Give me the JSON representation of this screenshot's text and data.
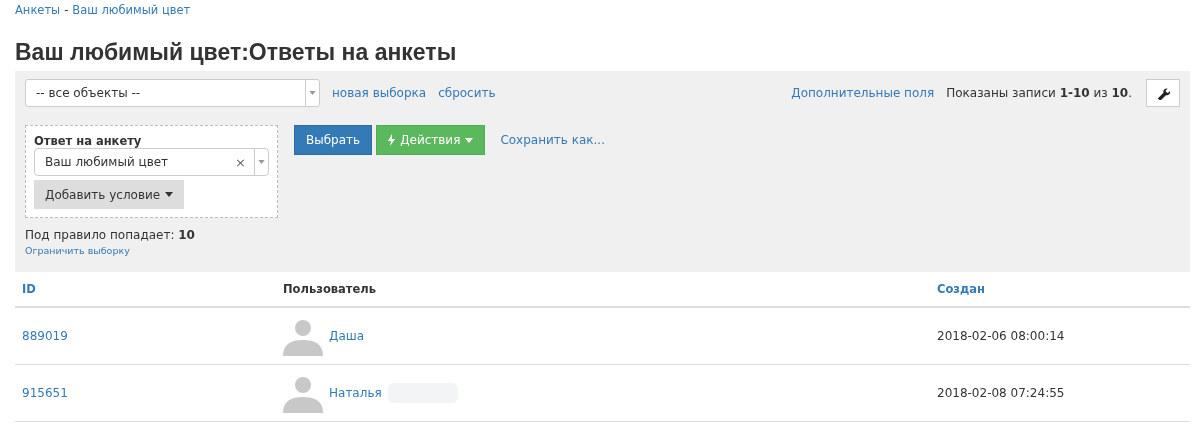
{
  "breadcrumb": [
    {
      "label": "Анкеты"
    },
    {
      "label": "Ваш любимый цвет"
    }
  ],
  "breadcrumb_separator": "-",
  "title": "Ваш любимый цвет:Ответы на анкеты",
  "filter_bar": {
    "object_select": "-- все объекты --",
    "links": [
      "новая выборка",
      "сбросить"
    ],
    "extra_fields_link": "Дополнительные поля",
    "records_info": "Показаны записи **1-10** из **10**."
  },
  "condition": {
    "label": "Ответ на анкету",
    "value": "Ваш любимый цвет",
    "clear": "×",
    "add_button": "Добавить условие"
  },
  "buttons": {
    "select": "Выбрать",
    "actions": "Действия",
    "save_as": "Сохранить как..."
  },
  "rule_count": "Под правило попадает: **10**",
  "limit_link": "Ограничить выборку",
  "table": {
    "columns": [
      {
        "label": "ID",
        "sortable": true
      },
      {
        "label": "Пользователь",
        "sortable": false
      },
      {
        "label": "Создан",
        "sortable": true
      }
    ],
    "rows": [
      {
        "id": "889019",
        "user": "Даша",
        "redacted": false,
        "created": "2018-02-06 08:00:14"
      },
      {
        "id": "915651",
        "user": "Наталья",
        "redacted": true,
        "created": "2018-02-08 07:24:55"
      }
    ]
  }
}
